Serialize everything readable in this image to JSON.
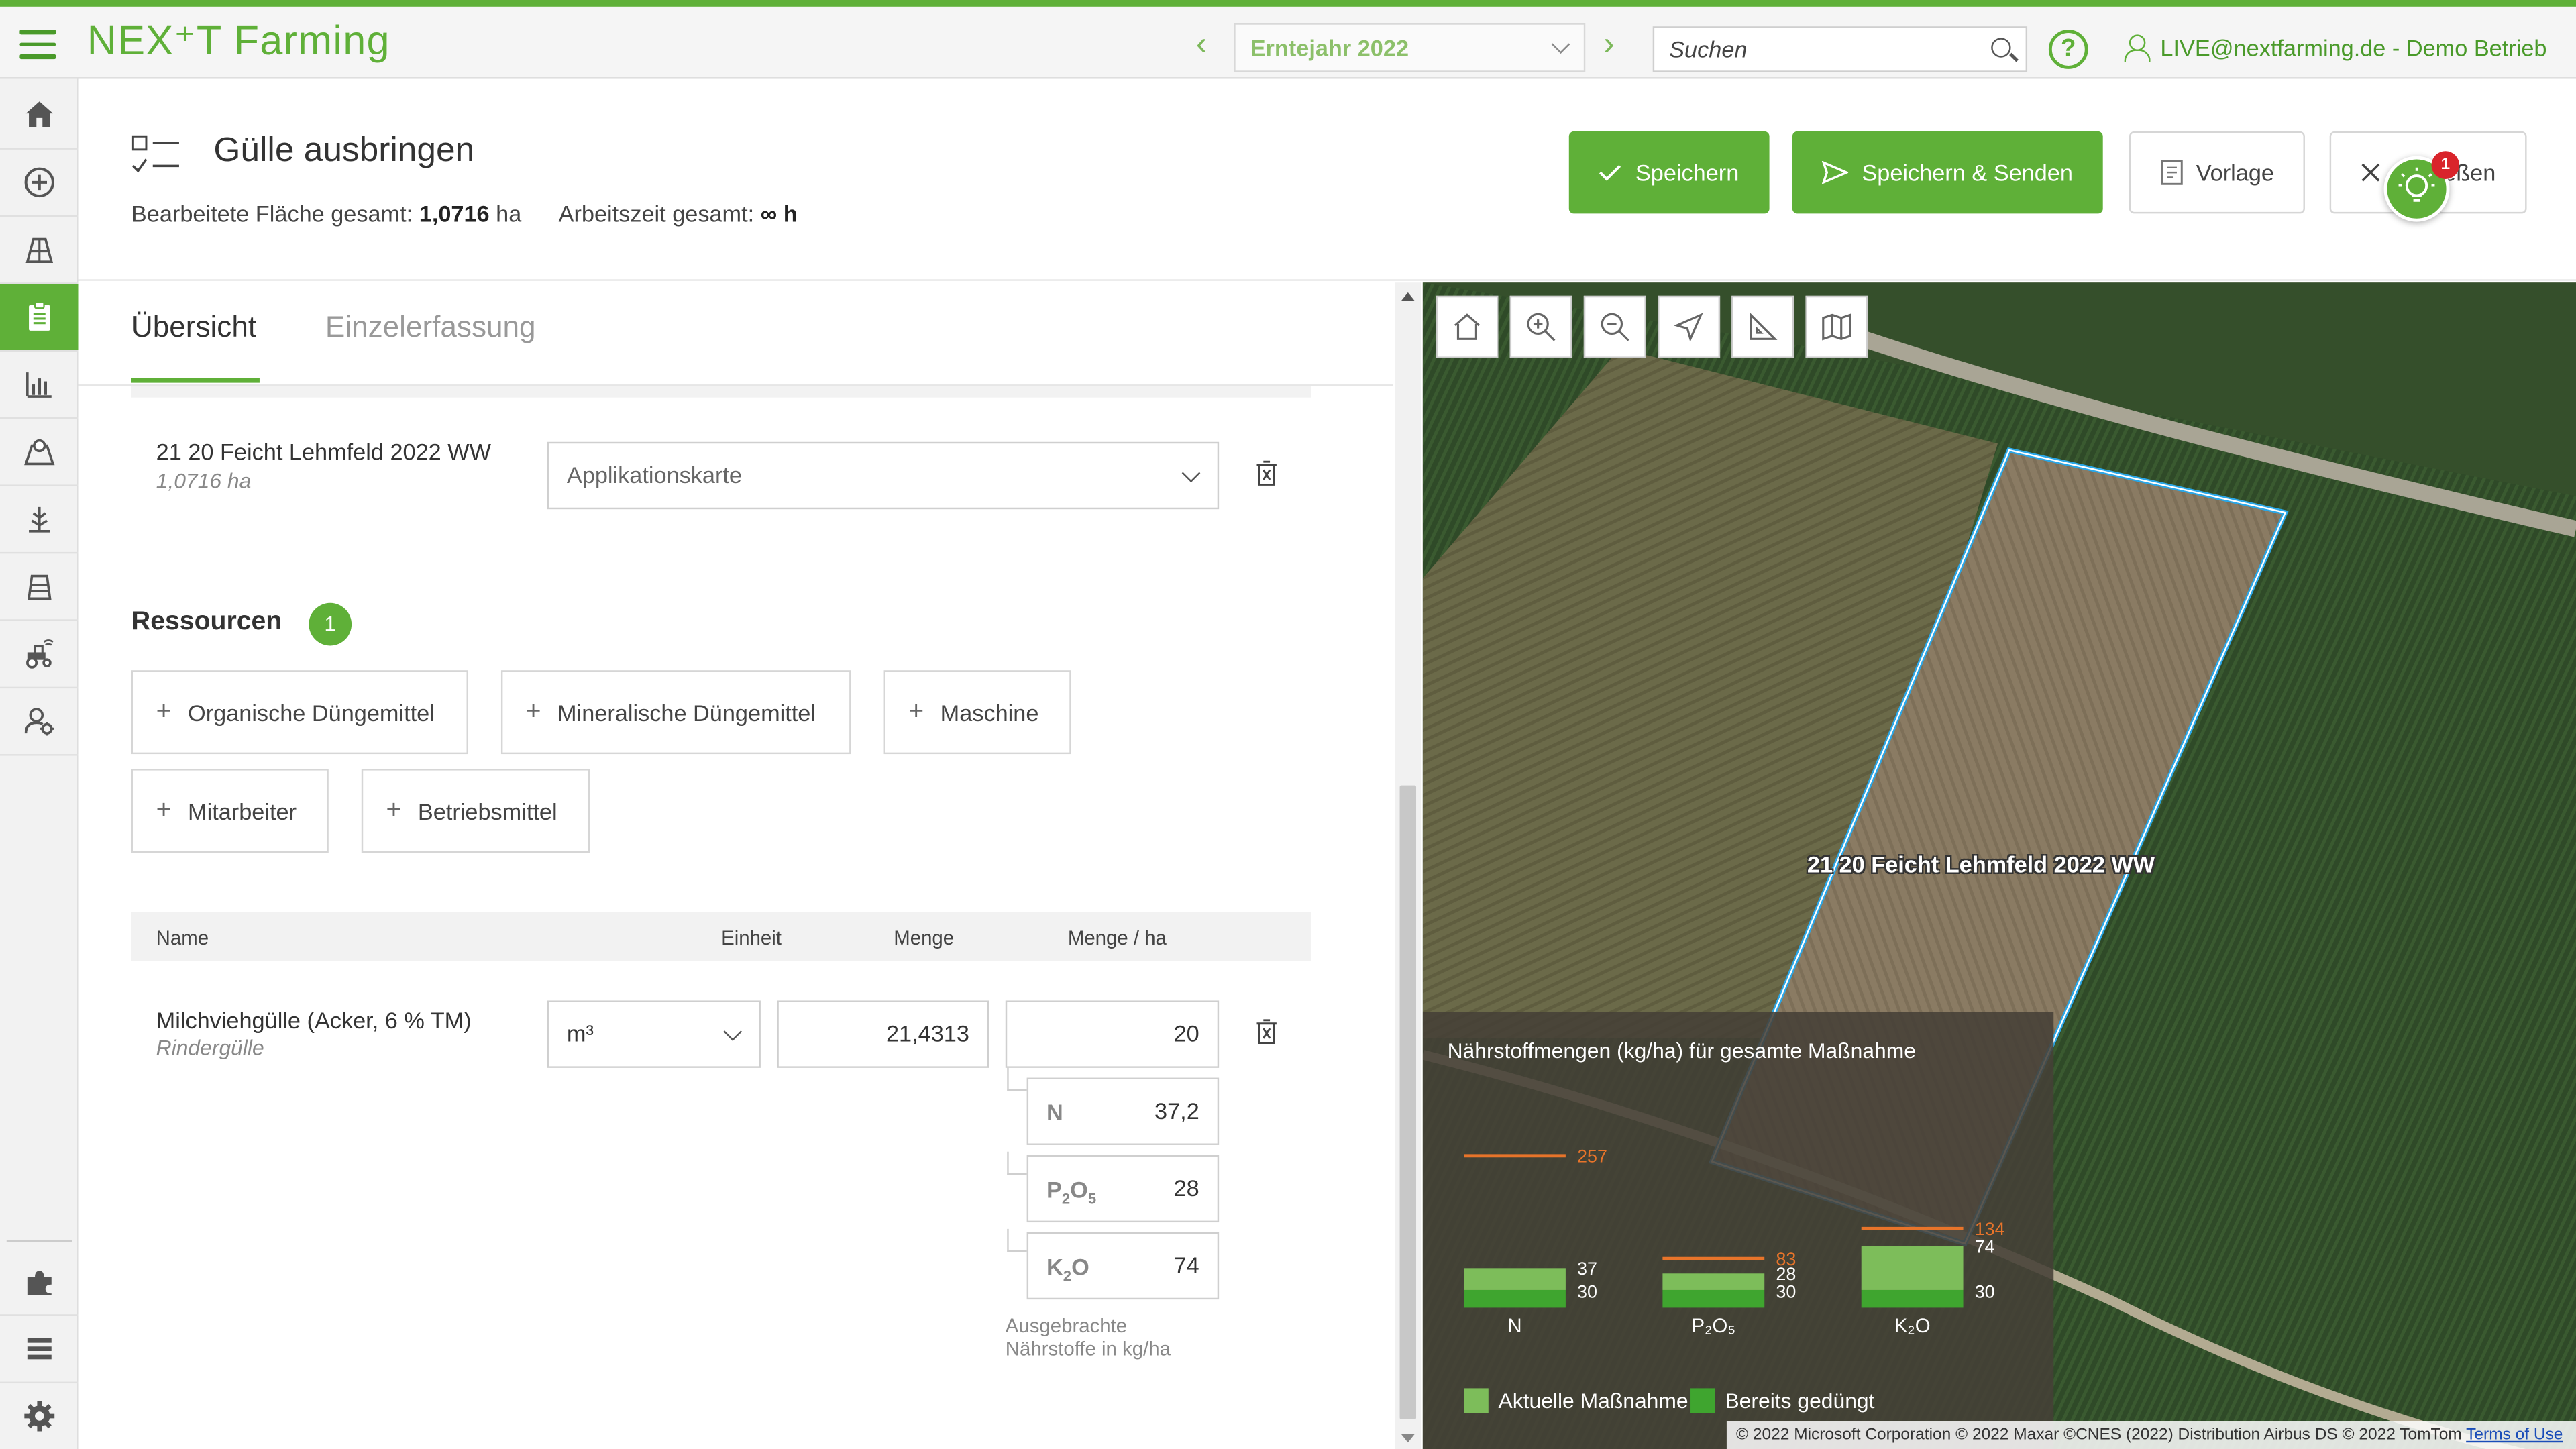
{
  "topbar": {
    "logo": "NEX⁺T Farming",
    "year": "Erntejahr 2022",
    "search_placeholder": "Suchen",
    "user": "LIVE@nextfarming.de - Demo Betrieb"
  },
  "sidebar": {
    "items": [
      "home",
      "add",
      "fields",
      "tasks",
      "reports",
      "map",
      "crop",
      "storage",
      "machinery",
      "staff",
      "plugins",
      "list",
      "settings"
    ]
  },
  "header": {
    "title": "Gülle ausbringen",
    "area_label": "Bearbeitete Fläche gesamt:",
    "area_value": "1,0716",
    "area_unit": "ha",
    "time_label": "Arbeitszeit gesamt:",
    "time_value": "∞",
    "time_unit": "h",
    "buttons": {
      "save": "Speichern",
      "save_send": "Speichern & Senden",
      "template": "Vorlage",
      "close": "Schließen"
    },
    "notification_count": "1"
  },
  "tabs": {
    "overview": "Übersicht",
    "single": "Einzelerfassung"
  },
  "field": {
    "name": "21 20 Feicht Lehmfeld 2022 WW",
    "area": "1,0716 ha",
    "map_placeholder": "Applikationskarte"
  },
  "resources": {
    "title": "Ressourcen",
    "count": "1",
    "buttons": [
      "Organische Düngemittel",
      "Mineralische Düngemittel",
      "Maschine",
      "Mitarbeiter",
      "Betriebsmittel"
    ]
  },
  "table": {
    "headers": {
      "name": "Name",
      "unit": "Einheit",
      "amount": "Menge",
      "amount_ha": "Menge / ha"
    },
    "row": {
      "name": "Milchviehgülle (Acker, 6 % TM)",
      "sub": "Rindergülle",
      "unit": "m³",
      "amount": "21,4313",
      "amount_ha": "20"
    },
    "nutrients": [
      {
        "label": "N",
        "value": "37,2"
      },
      {
        "label": "P2O5",
        "value": "28"
      },
      {
        "label": "K2O",
        "value": "74"
      }
    ],
    "note_line1": "Ausgebrachte",
    "note_line2": "Nährstoffe in kg/ha"
  },
  "map": {
    "field_label": "21 20 Feicht Lehmfeld 2022 WW",
    "attribution": "© 2022 Microsoft Corporation © 2022 Maxar ©CNES (2022) Distribution Airbus DS © 2022 TomTom",
    "terms": "Terms of Use"
  },
  "chart_data": {
    "type": "bar",
    "title": "Nährstoffmengen (kg/ha) für gesamte Maßnahme",
    "categories": [
      "N",
      "P2O5",
      "K2O"
    ],
    "series": [
      {
        "name": "Aktuelle Maßnahme",
        "values": [
          37,
          28,
          74
        ],
        "color": "#7dbd5a"
      },
      {
        "name": "Bereits gedüngt",
        "values": [
          30,
          30,
          30
        ],
        "color": "#3fa52f"
      }
    ],
    "targets": [
      257,
      83,
      134
    ],
    "target_color": "#e8742a",
    "legend": [
      "Aktuelle Maßnahme",
      "Bereits gedüngt"
    ]
  }
}
